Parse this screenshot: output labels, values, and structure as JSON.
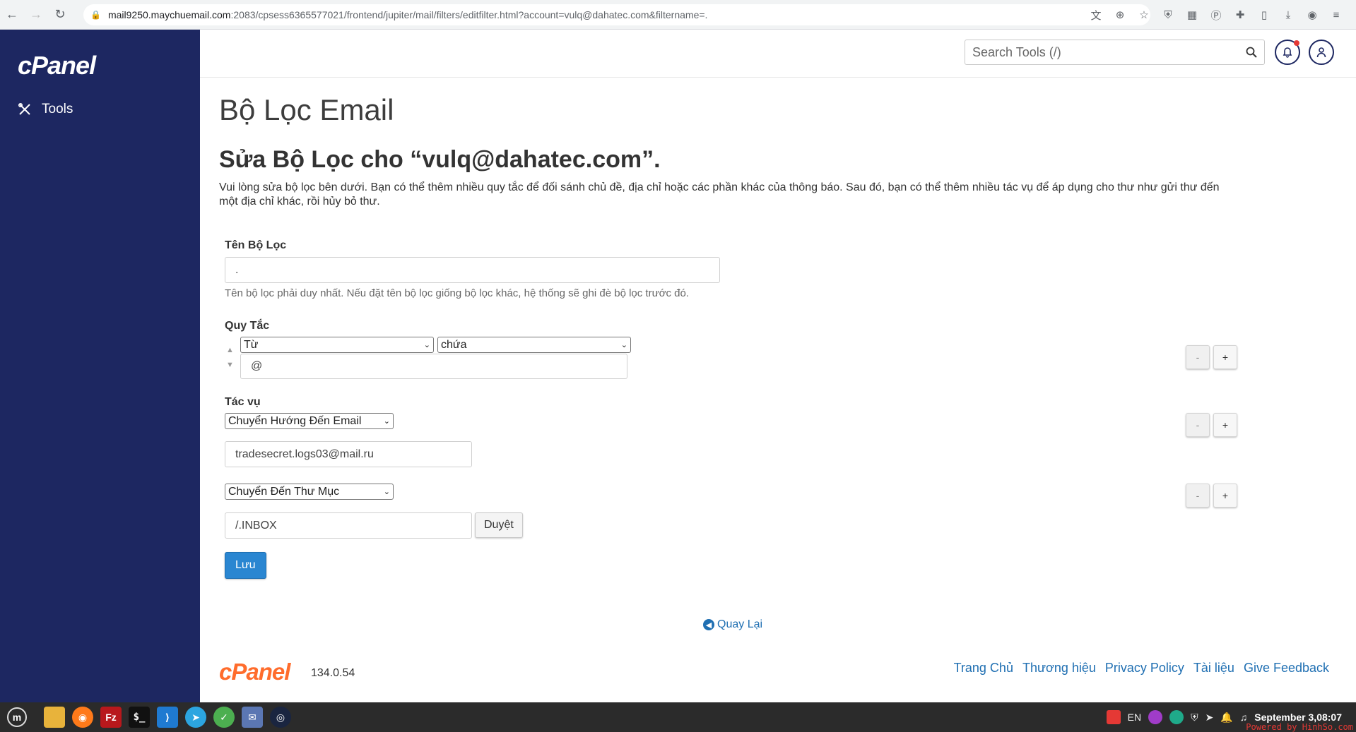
{
  "browser": {
    "url_host": "mail9250.maychuemail.com",
    "url_rest": ":2083/cpsess6365577021/frontend/jupiter/mail/filters/editfilter.html?account=vulq@dahatec.com&filtername=."
  },
  "sidebar": {
    "logo": "cPanel",
    "items": [
      {
        "label": "Tools",
        "icon": "tools-icon"
      }
    ]
  },
  "header": {
    "search_placeholder": "Search Tools (/)"
  },
  "page": {
    "title": "Bộ Lọc Email",
    "subtitle": "Sửa Bộ Lọc cho “vulq@dahatec.com”.",
    "intro": "Vui lòng sửa bộ lọc bên dưới. Bạn có thể thêm nhiều quy tắc để đối sánh chủ đề, địa chỉ hoặc các phần khác của thông báo. Sau đó, bạn có thể thêm nhiều tác vụ để áp dụng cho thư như gửi thư đến một địa chỉ khác, rồi hủy bỏ thư."
  },
  "form": {
    "filter_name_label": "Tên Bộ Lọc",
    "filter_name_value": ".",
    "filter_name_help": "Tên bộ lọc phải duy nhất. Nếu đặt tên bộ lọc giống bộ lọc khác, hệ thống sẽ ghi đè bộ lọc trước đó.",
    "rules_label": "Quy Tắc",
    "rule": {
      "part": "Từ",
      "match": "chứa",
      "value": "@"
    },
    "actions_label": "Tác vụ",
    "actions": [
      {
        "type": "Chuyển Hướng Đến Email",
        "value": "tradesecret.logs03@mail.ru"
      },
      {
        "type": "Chuyển Đến Thư Mục",
        "value": "/.INBOX",
        "browse_label": "Duyệt"
      }
    ],
    "minus_label": "-",
    "plus_label": "+",
    "save_label": "Lưu",
    "back_label": "Quay Lại"
  },
  "footer": {
    "logo": "cPanel",
    "version": "134.0.54",
    "links": [
      "Trang Chủ",
      "Thương hiệu",
      "Privacy Policy",
      "Tài liệu",
      "Give Feedback"
    ]
  },
  "taskbar": {
    "lang": "EN",
    "clock": "September  3,08:07",
    "watermark": "Powered by HinhSo.com"
  },
  "colors": {
    "sidebar": "#1d2761",
    "accent": "#2a86d1",
    "brand_orange": "#ff6c2c"
  }
}
